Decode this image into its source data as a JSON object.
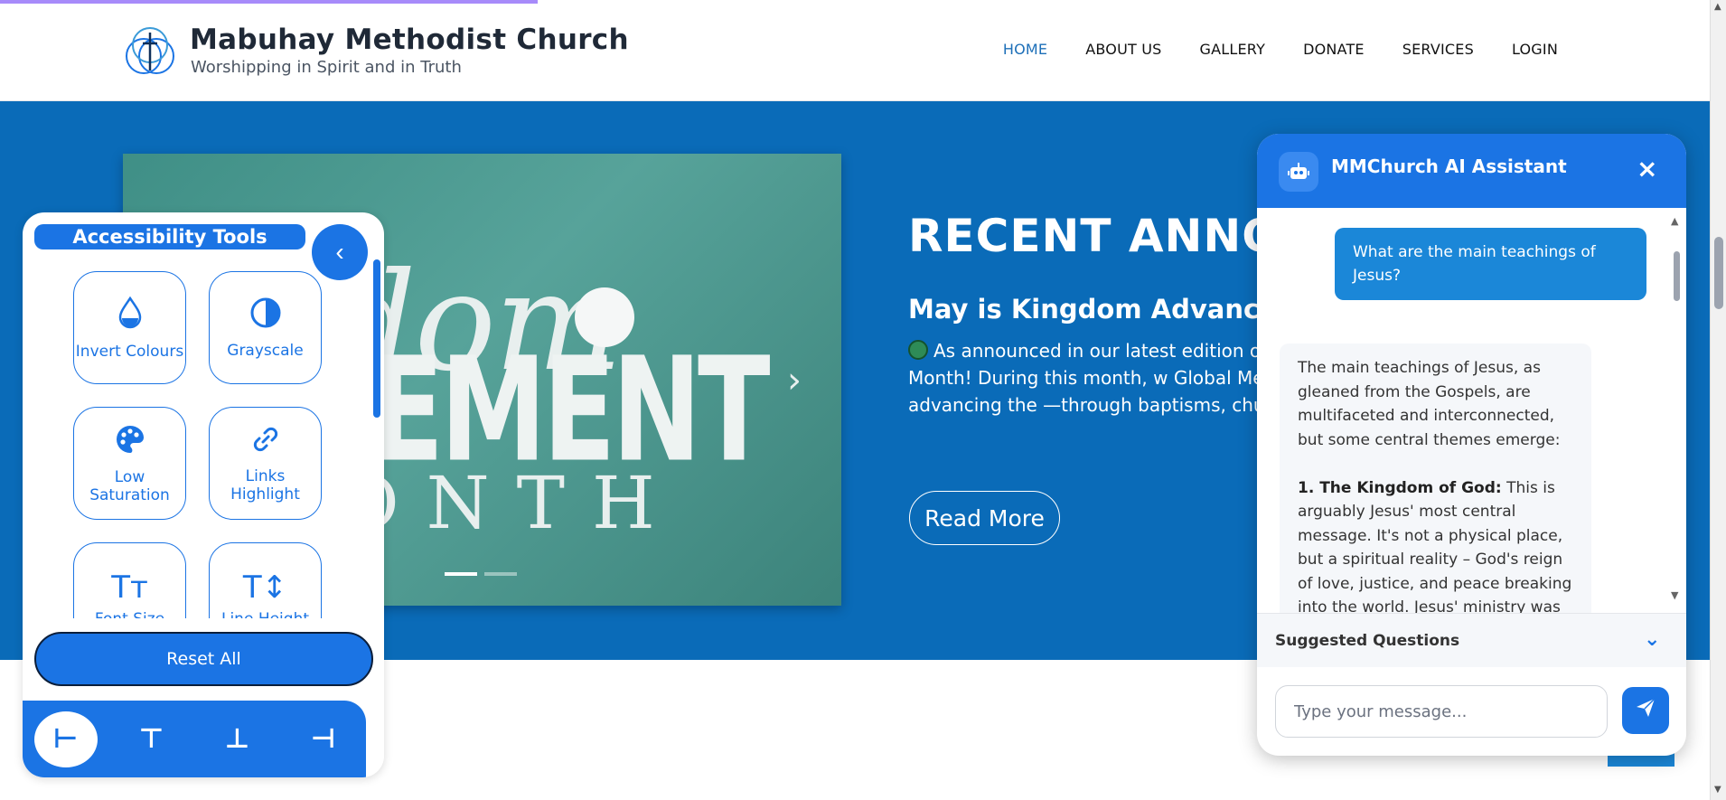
{
  "header": {
    "title": "Mabuhay Methodist Church",
    "tagline": "Worshipping in Spirit and in Truth",
    "nav": [
      "HOME",
      "ABOUT US",
      "GALLERY",
      "DONATE",
      "SERVICES",
      "LOGIN"
    ],
    "active_nav": "HOME",
    "scroll_progress": 0.31
  },
  "slide": {
    "line1": "ngdom",
    "line2": "ANCEMENT",
    "line3": "ONTH",
    "arrow": "›",
    "dots_count": 2,
    "active_dot": 1
  },
  "announcement": {
    "heading": "RECENT ANNOU",
    "title": "May is Kingdom Advancem",
    "body": "As announced in our latest edition of A Advancement Month! During this month, w Global Methodist Church is advancing the —through baptisms, church planting, missi",
    "read_more": "Read More"
  },
  "accessibility": {
    "title": "Accessibility Tools",
    "toggle_icon": "‹",
    "tools": [
      {
        "label": "Invert Colours",
        "icon": "droplet-icon",
        "glyph": "💧"
      },
      {
        "label": "Grayscale",
        "icon": "contrast-icon",
        "glyph": "◐"
      },
      {
        "label": "Low Saturation",
        "icon": "palette-icon",
        "glyph": "🎨"
      },
      {
        "label": "Links Highlight",
        "icon": "link-icon",
        "glyph": "🔗"
      },
      {
        "label": "Font Size",
        "icon": "font-size-icon",
        "glyph": "Tт"
      },
      {
        "label": "Line Height",
        "icon": "line-height-icon",
        "glyph": "T↕"
      }
    ],
    "reset_label": "Reset All",
    "position_buttons": [
      "align-left-icon",
      "align-top-icon",
      "align-bottom-icon",
      "align-right-icon"
    ],
    "position_glyphs": [
      "⊢",
      "⊤",
      "⊥",
      "⊣"
    ],
    "selected_position": 0
  },
  "chat": {
    "title": "MMChurch AI Assistant",
    "close_icon": "×",
    "user_message": "What are the main teachings of Jesus?",
    "bot_intro": "The main teachings of Jesus, as gleaned from the Gospels, are multifaceted and interconnected, but some central themes emerge:",
    "bot_point_title": "1. The Kingdom of God:",
    "bot_point_text": "This is arguably Jesus' most central message. It's not a physical place, but a spiritual reality – God's reign of love, justice, and peace breaking into the world. Jesus' ministry was about",
    "suggested_label": "Suggested Questions",
    "input_placeholder": "Type your message...",
    "send_icon": "paper-plane-icon"
  },
  "colors": {
    "primary_blue": "#1b74e4",
    "hero_blue": "#0a6bb8",
    "progress": "#a78bfa"
  }
}
